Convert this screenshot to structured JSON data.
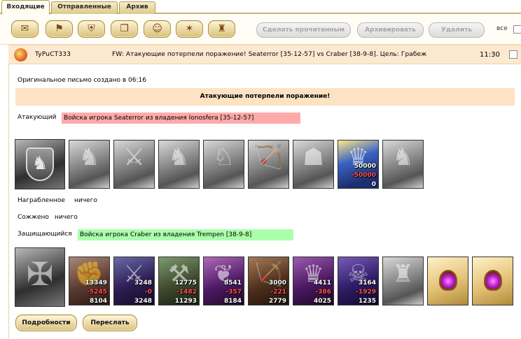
{
  "tabs": [
    {
      "label": "Входящие",
      "active": true
    },
    {
      "label": "Отправленные",
      "active": false
    },
    {
      "label": "Архив",
      "active": false
    }
  ],
  "toolbar": {
    "icons": [
      "scroll-icon",
      "flag-icon",
      "shield-icon",
      "book-icon",
      "alliance-icon",
      "star-icon",
      "castle-icon"
    ],
    "mark_read_label": "Сделать прочитанным",
    "archive_label": "Архивировать",
    "delete_label": "Удалить",
    "all_label": "все"
  },
  "message": {
    "sender": "TyPuCT333",
    "subject": "FW: Атакующие потерпели поражение! Seaterror [35-12-57] vs Craber [38-9-8]. Цель: Грабеж",
    "time": "11:30",
    "created": "Оригинальное письмо создано в 06:16",
    "result": "Атакующие потерпели поражение!"
  },
  "attacker": {
    "label": "Атакующий",
    "army": "Войска игрока Seaterror из владения Ionosfera [35-12-57]",
    "units": [
      {
        "style": "gray",
        "glyph": "♞"
      },
      {
        "style": "gray",
        "glyph": "⚔"
      },
      {
        "style": "gray",
        "glyph": "♞"
      },
      {
        "style": "gray",
        "glyph": "♘"
      },
      {
        "style": "gray",
        "glyph": "🏹"
      },
      {
        "style": "gray",
        "glyph": "☗"
      },
      {
        "style": "blue",
        "glyph": "♛",
        "count": "50000",
        "loss": "-50000",
        "left": "0"
      },
      {
        "style": "gray",
        "glyph": "♞"
      }
    ]
  },
  "loot": {
    "label": "Награбленное",
    "value": "ничего"
  },
  "burned": {
    "label": "Сожжено",
    "value": "ничего"
  },
  "defender": {
    "label": "Защищающийся",
    "army": "Войска игрока Craber из владения Trempen [38-9-8]",
    "units": [
      {
        "style": "color1",
        "glyph": "✊",
        "count": "13349",
        "loss": "-5245",
        "left": "8104"
      },
      {
        "style": "color2",
        "glyph": "⚔",
        "count": "3248",
        "loss": "-0",
        "left": "3248"
      },
      {
        "style": "color3",
        "glyph": "⚒",
        "count": "12775",
        "loss": "-1482",
        "left": "11293"
      },
      {
        "style": "color4",
        "glyph": "❦",
        "count": "8541",
        "loss": "-357",
        "left": "8184"
      },
      {
        "style": "color5",
        "glyph": "🏹",
        "count": "3000",
        "loss": "-221",
        "left": "2779"
      },
      {
        "style": "color6",
        "glyph": "♛",
        "count": "4411",
        "loss": "-386",
        "left": "4025"
      },
      {
        "style": "color7",
        "glyph": "☠",
        "count": "3164",
        "loss": "-1929",
        "left": "1235"
      },
      {
        "style": "gray",
        "glyph": "♜"
      },
      {
        "style": "color8",
        "orb": true
      },
      {
        "style": "color8",
        "orb": true
      }
    ]
  },
  "buttons": {
    "details_label": "Подробности",
    "forward_label": "Переслать"
  }
}
